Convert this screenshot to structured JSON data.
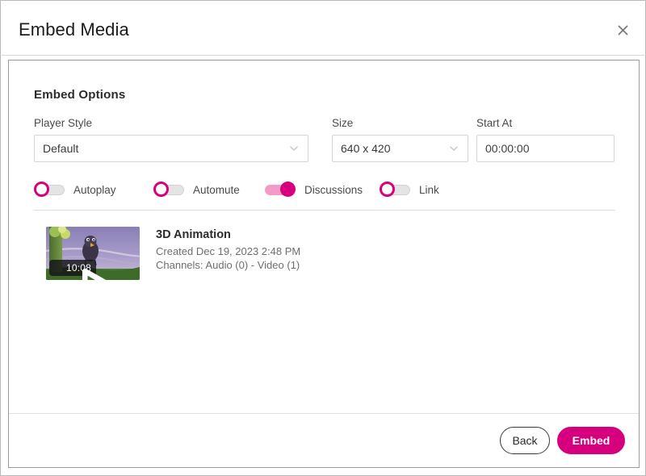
{
  "dialog": {
    "title": "Embed Media",
    "close_icon": "close-icon"
  },
  "content": {
    "section_title": "Embed Options",
    "fields": {
      "player_style": {
        "label": "Player Style",
        "value": "Default",
        "icon": "chevron-down-icon"
      },
      "size": {
        "label": "Size",
        "value": "640 x 420",
        "icon": "chevron-down-icon"
      },
      "start_at": {
        "label": "Start At",
        "value": "00:00:00",
        "placeholder": "00:00:00"
      }
    },
    "toggles": [
      {
        "label": "Autoplay",
        "state": "off"
      },
      {
        "label": "Automute",
        "state": "off"
      },
      {
        "label": "Discussions",
        "state": "on"
      },
      {
        "label": "Link",
        "state": "off"
      }
    ],
    "media": {
      "title": "3D Animation",
      "created": "Created Dec 19, 2023 2:48 PM",
      "channels": "Channels: Audio (0) - Video (1)",
      "duration": "10:08",
      "play_icon": "play-icon"
    }
  },
  "footer": {
    "back_label": "Back",
    "embed_label": "Embed"
  },
  "colors": {
    "accent": "#d6007f",
    "accent_light": "#f49ac8",
    "text": "#2b2b2b",
    "muted": "#6e6e6e",
    "border": "#d4d4d4"
  }
}
